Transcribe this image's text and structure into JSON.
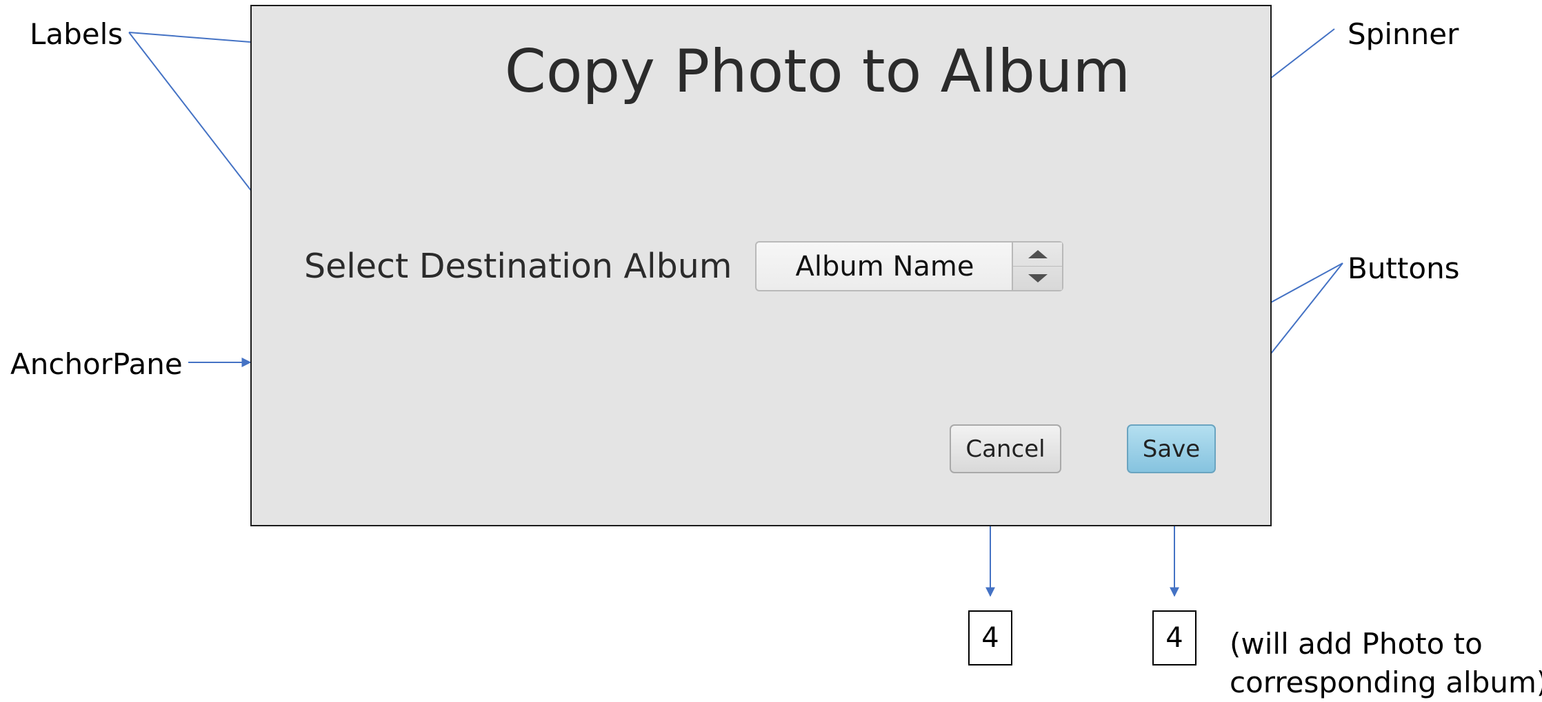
{
  "annotations": {
    "labels": "Labels",
    "spinner": "Spinner",
    "anchor_pane": "AnchorPane",
    "buttons": "Buttons"
  },
  "dialog": {
    "title": "Copy Photo to Album",
    "select_label": "Select Destination Album",
    "spinner_value": "Album Name",
    "cancel_label": "Cancel",
    "save_label": "Save"
  },
  "flow": {
    "cancel_target": "4",
    "save_target": "4",
    "save_note_line1": "(will add Photo to",
    "save_note_line2": "corresponding album)"
  },
  "colors": {
    "arrow": "#4472c4",
    "pane_background": "#e4e4e4",
    "save_button": "#9fd0e8"
  }
}
